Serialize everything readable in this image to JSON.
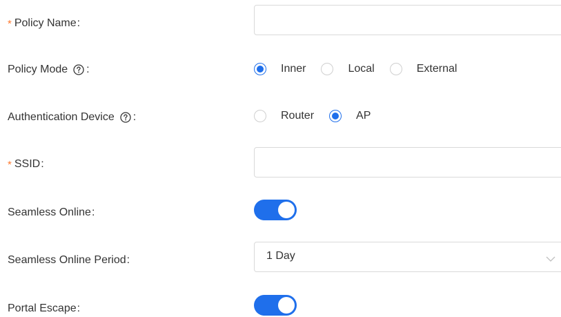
{
  "form": {
    "policy_name": {
      "required_mark": "*",
      "label": "Policy Name",
      "colon": ":",
      "value": ""
    },
    "policy_mode": {
      "label": "Policy Mode",
      "colon": ":",
      "options": [
        {
          "label": "Inner",
          "checked": true
        },
        {
          "label": "Local",
          "checked": false
        },
        {
          "label": "External",
          "checked": false
        }
      ]
    },
    "authentication_device": {
      "label": "Authentication Device",
      "colon": ":",
      "options": [
        {
          "label": "Router",
          "checked": false
        },
        {
          "label": "AP",
          "checked": true
        }
      ]
    },
    "ssid": {
      "required_mark": "*",
      "label": "SSID",
      "colon": ":",
      "value": ""
    },
    "seamless_online": {
      "label": "Seamless Online",
      "colon": ":",
      "enabled": true
    },
    "seamless_online_period": {
      "label": "Seamless Online Period",
      "colon": ":",
      "selected": "1 Day"
    },
    "portal_escape": {
      "label": "Portal Escape",
      "colon": ":",
      "enabled": true
    }
  },
  "colors": {
    "accent": "#1f6feb",
    "required": "#ff7a2f",
    "border": "#d9d9d9",
    "text": "#333333"
  },
  "icons": {
    "help": "question-circle-icon",
    "dropdown": "chevron-down-icon"
  }
}
